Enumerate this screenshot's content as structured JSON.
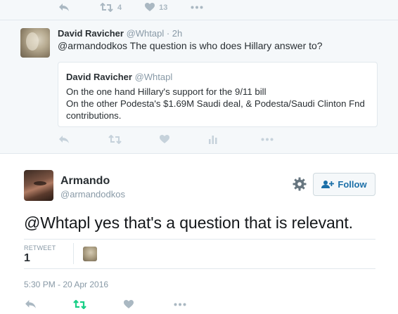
{
  "top_actions": {
    "retweet_count": "4",
    "like_count": "13"
  },
  "reply_tweet": {
    "author_name": "David Ravicher",
    "author_handle": "@Whtapl",
    "time_ago": "· 2h",
    "text": "@armandodkos The question is who does Hillary answer to?",
    "quoted": {
      "author_name": "David Ravicher",
      "author_handle": "@Whtapl",
      "lines": [
        "On the one hand Hillary's support for the 9/11 bill",
        "On the other Podesta's $1.69M Saudi deal, & Podesta/Saudi Clinton Fnd",
        "contributions."
      ]
    }
  },
  "main_tweet": {
    "author_name": "Armando",
    "author_handle": "@armandodkos",
    "follow_label": "Follow",
    "text": "@Whtapl yes that's a question that is relevant.",
    "stats": {
      "retweet_label": "RETWEET",
      "retweet_count": "1"
    },
    "timestamp": "5:30 PM - 20 Apr 2016"
  },
  "colors": {
    "accent_blue": "#1b6fa8",
    "retweeted_green": "#19cf86",
    "icon_gray": "#aab8c2",
    "reply_bg": "#f5f8fa"
  },
  "icons": {
    "reply": "reply-icon",
    "retweet": "retweet-icon",
    "like": "heart-icon",
    "analytics": "analytics-icon",
    "more": "more-dots-icon",
    "settings": "gear-icon",
    "follow": "add-user-icon"
  }
}
